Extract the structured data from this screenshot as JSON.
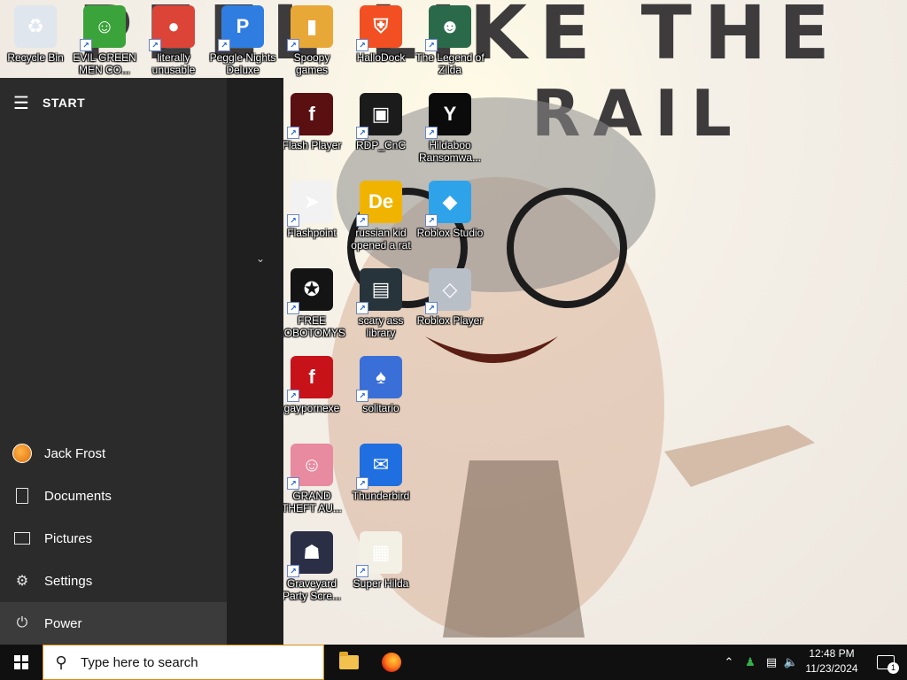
{
  "wallpaper": {
    "text_line1": "PEEL LIKE THE",
    "text_line2": "RAIL"
  },
  "desktop_icons": [
    {
      "label": "Recycle Bin",
      "icon": "recycle-bin-icon",
      "color": "#dfe6ee",
      "glyph": "♻"
    },
    {
      "label": "EVIL GREEN MEN CO...",
      "icon": "green-men-icon",
      "color": "#3aa33a",
      "glyph": "☺"
    },
    {
      "label": "literally unusable",
      "icon": "chrome-icon",
      "color": "#db4437",
      "glyph": "●"
    },
    {
      "label": "Peggle Nights Deluxe",
      "icon": "peggle-icon",
      "color": "#2f7de1",
      "glyph": "P"
    },
    {
      "label": "Spoopy games",
      "icon": "folder-icon",
      "color": "#e8a838",
      "glyph": "▮"
    },
    {
      "label": "HalloDock",
      "icon": "windows-shield-icon",
      "color": "#f25022",
      "glyph": "⛨"
    },
    {
      "label": "The Legend of Zilda",
      "icon": "zilda-icon",
      "color": "#2a6a4a",
      "glyph": "☻"
    },
    {
      "label": "Flash Player",
      "icon": "flash-icon",
      "color": "#5a0f10",
      "glyph": "f"
    },
    {
      "label": "RDP_CnC",
      "icon": "rdp-icon",
      "color": "#1b1b1b",
      "glyph": "▣"
    },
    {
      "label": "Hildaboo Ransomwa...",
      "icon": "yashma-icon",
      "color": "#0b0b0b",
      "glyph": "Y"
    },
    {
      "label": "Flashpoint",
      "icon": "flashpoint-icon",
      "color": "#f2f2f2",
      "glyph": "➤"
    },
    {
      "label": "russian kid opened a rat",
      "icon": "de-icon",
      "color": "#f0b400",
      "glyph": "De"
    },
    {
      "label": "Roblox Studio",
      "icon": "roblox-studio-icon",
      "color": "#2ea3ea",
      "glyph": "◆"
    },
    {
      "label": "FREE LOBOTOMYS",
      "icon": "lobotomy-icon",
      "color": "#141414",
      "glyph": "✪"
    },
    {
      "label": "scary ass library",
      "icon": "library-icon",
      "color": "#27343c",
      "glyph": "▤"
    },
    {
      "label": "Roblox Player",
      "icon": "roblox-player-icon",
      "color": "#b9bfc7",
      "glyph": "◇"
    },
    {
      "label": "gaypornexe",
      "icon": "flash-red-icon",
      "color": "#c8121a",
      "glyph": "f"
    },
    {
      "label": "solitario",
      "icon": "solitaire-icon",
      "color": "#3a6fd8",
      "glyph": "♠"
    },
    {
      "label": "GRAND THEFT AU...",
      "icon": "anime-girl-icon",
      "color": "#e88aa0",
      "glyph": "☺"
    },
    {
      "label": "Thunderbird",
      "icon": "thunderbird-icon",
      "color": "#1f6fe0",
      "glyph": "✉"
    },
    {
      "label": "Graveyard Party Scre...",
      "icon": "graveyard-icon",
      "color": "#2a2f45",
      "glyph": "☗"
    },
    {
      "label": "Super Hilda",
      "icon": "super-hilda-icon",
      "color": "#f3f0e6",
      "glyph": "▦"
    }
  ],
  "start_menu": {
    "title": "START",
    "items": [
      {
        "label": "Jack Frost",
        "icon": "user-avatar-icon"
      },
      {
        "label": "Documents",
        "icon": "document-icon"
      },
      {
        "label": "Pictures",
        "icon": "pictures-icon"
      },
      {
        "label": "Settings",
        "icon": "gear-icon"
      },
      {
        "label": "Power",
        "icon": "power-icon"
      }
    ]
  },
  "taskbar": {
    "search_placeholder": "Type here to search",
    "apps": [
      {
        "name": "File Explorer",
        "icon": "file-explorer-icon"
      },
      {
        "name": "Firefox",
        "icon": "firefox-icon"
      }
    ],
    "time": "12:48 PM",
    "date": "11/23/2024",
    "notification_count": "1",
    "accent": "#d98b1a"
  }
}
